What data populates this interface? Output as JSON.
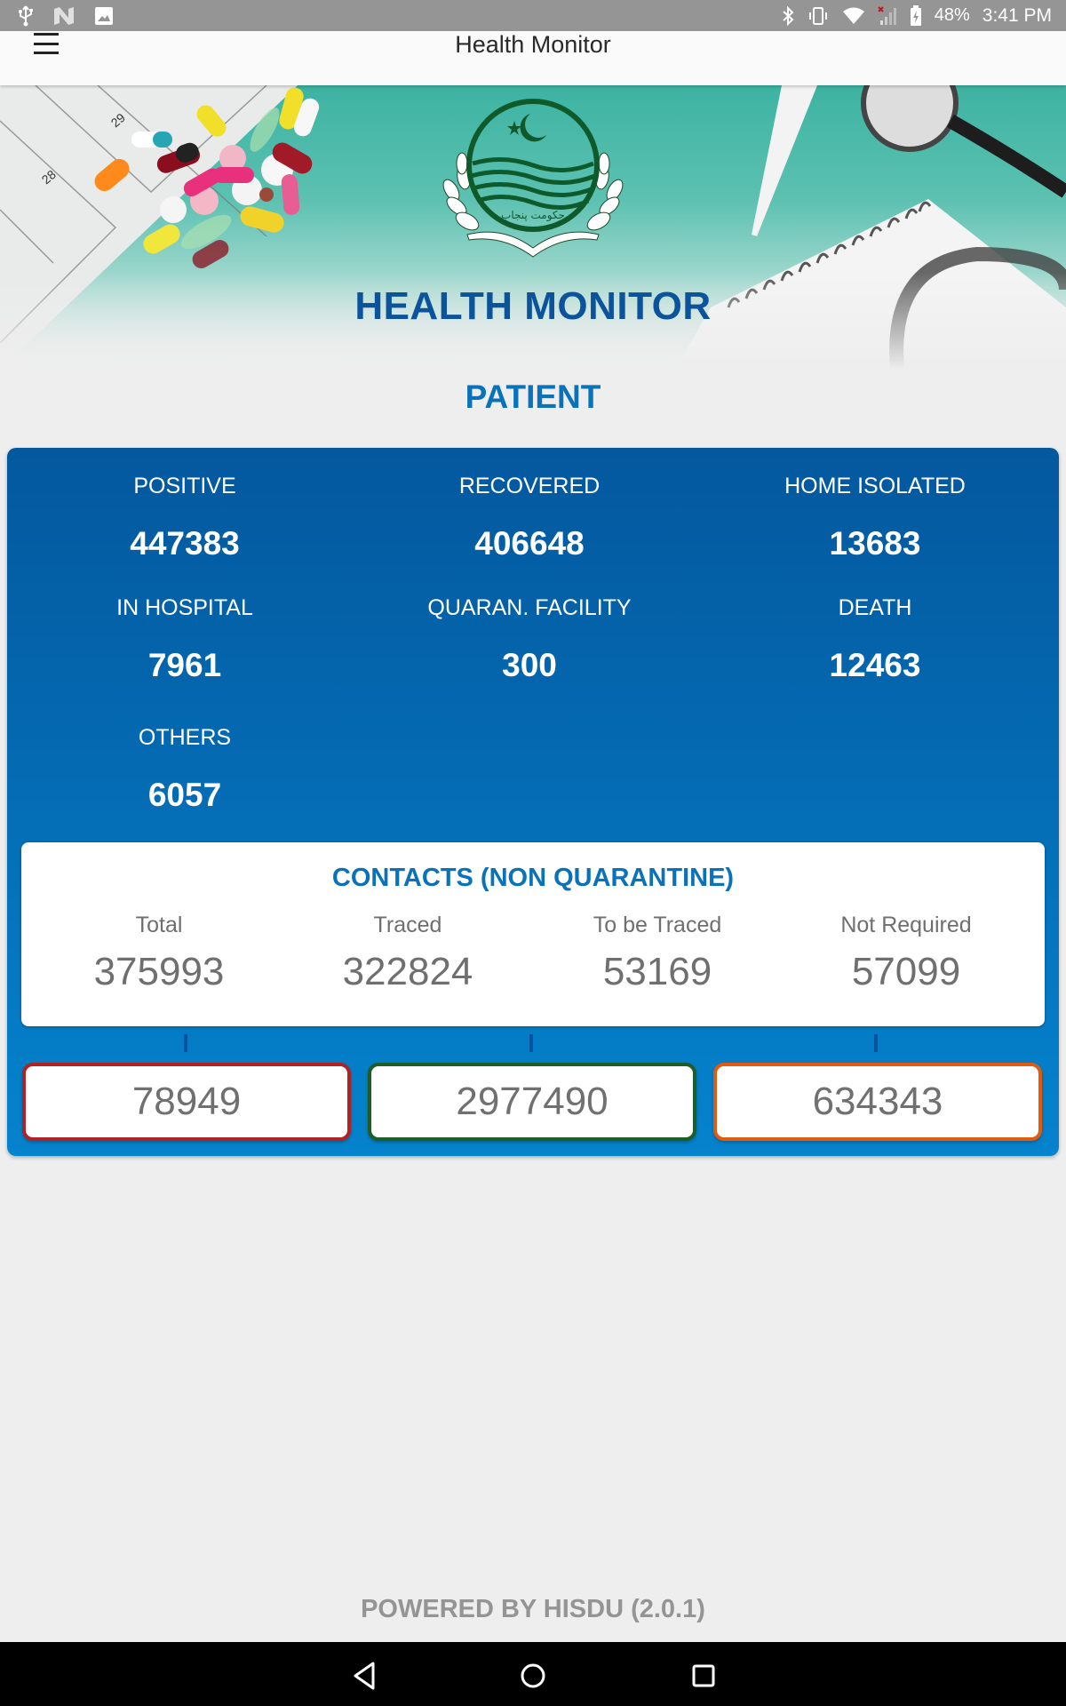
{
  "status_bar": {
    "left_icons": [
      "usb-icon",
      "n-icon",
      "image-icon"
    ],
    "right_icons": [
      "bluetooth-icon",
      "vibrate-icon",
      "wifi-icon",
      "no-signal-icon",
      "battery-charging-icon"
    ],
    "battery": "48%",
    "time": "3:41 PM"
  },
  "app_bar": {
    "title": "Health Monitor",
    "menu_icon": "hamburger-menu-icon"
  },
  "hero": {
    "title": "HEALTH MONITOR",
    "emblem": "punjab-government-emblem",
    "emblem_text": "حکومت پنجاب",
    "calendar_numbers": [
      "29",
      "28"
    ]
  },
  "section": {
    "title": "PATIENT"
  },
  "stats": [
    {
      "label": "POSITIVE",
      "value": "447383"
    },
    {
      "label": "RECOVERED",
      "value": "406648"
    },
    {
      "label": "HOME ISOLATED",
      "value": "13683"
    },
    {
      "label": "IN HOSPITAL",
      "value": "7961"
    },
    {
      "label": "QUARAN. FACILITY",
      "value": "300"
    },
    {
      "label": "DEATH",
      "value": "12463"
    },
    {
      "label": "OTHERS",
      "value": "6057"
    }
  ],
  "contacts": {
    "title": "CONTACTS (NON QUARANTINE)",
    "columns": [
      {
        "label": "Total",
        "value": "375993"
      },
      {
        "label": "Traced",
        "value": "322824"
      },
      {
        "label": "To be Traced",
        "value": "53169"
      },
      {
        "label": "Not Required",
        "value": "57099"
      }
    ]
  },
  "bottom_boxes": [
    {
      "value": "78949",
      "border_color": "#b22222"
    },
    {
      "value": "2977490",
      "border_color": "#1e5e24"
    },
    {
      "value": "634343",
      "border_color": "#e15b0f"
    }
  ],
  "footer": {
    "text": "POWERED BY HISDU (2.0.1)"
  },
  "nav_bar": {
    "buttons": [
      "back-icon",
      "home-icon",
      "recents-icon"
    ]
  }
}
